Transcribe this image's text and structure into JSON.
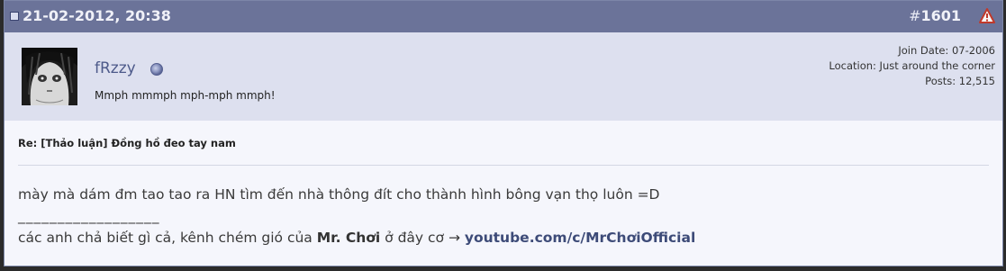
{
  "post": {
    "date": "21-02-2012, 20:38",
    "number_hash": "#",
    "number": "1601",
    "user": {
      "username": "fRzzy",
      "usertitle": "Mmph mmmph mph-mph mmph!",
      "join_date": "Join Date: 07-2006",
      "location": "Location: Just around the corner",
      "posts": "Posts: 12,515"
    },
    "title": "Re: [Thảo luận] Đồng hồ đeo tay nam",
    "message": {
      "line1": "mày mà dám đm tao tao ra HN tìm đến nhà thông đít cho thành hình bông vạn thọ luôn =D",
      "separator": "__________________",
      "sig_prefix": "các anh chả biết gì cả, kênh chém gió của ",
      "sig_name": "Mr. Chơi",
      "sig_middle": " ở đây cơ → ",
      "sig_link": "youtube.com/c/MrChơiOfficial"
    }
  },
  "icons": {
    "status": "post-status-icon",
    "report": "report-warning-icon",
    "online": "online-status-icon"
  },
  "colors": {
    "header_bg": "#6b7399",
    "userinfo_bg": "#dde0ef",
    "body_bg": "#f5f6fc",
    "link": "#3d4b78"
  }
}
